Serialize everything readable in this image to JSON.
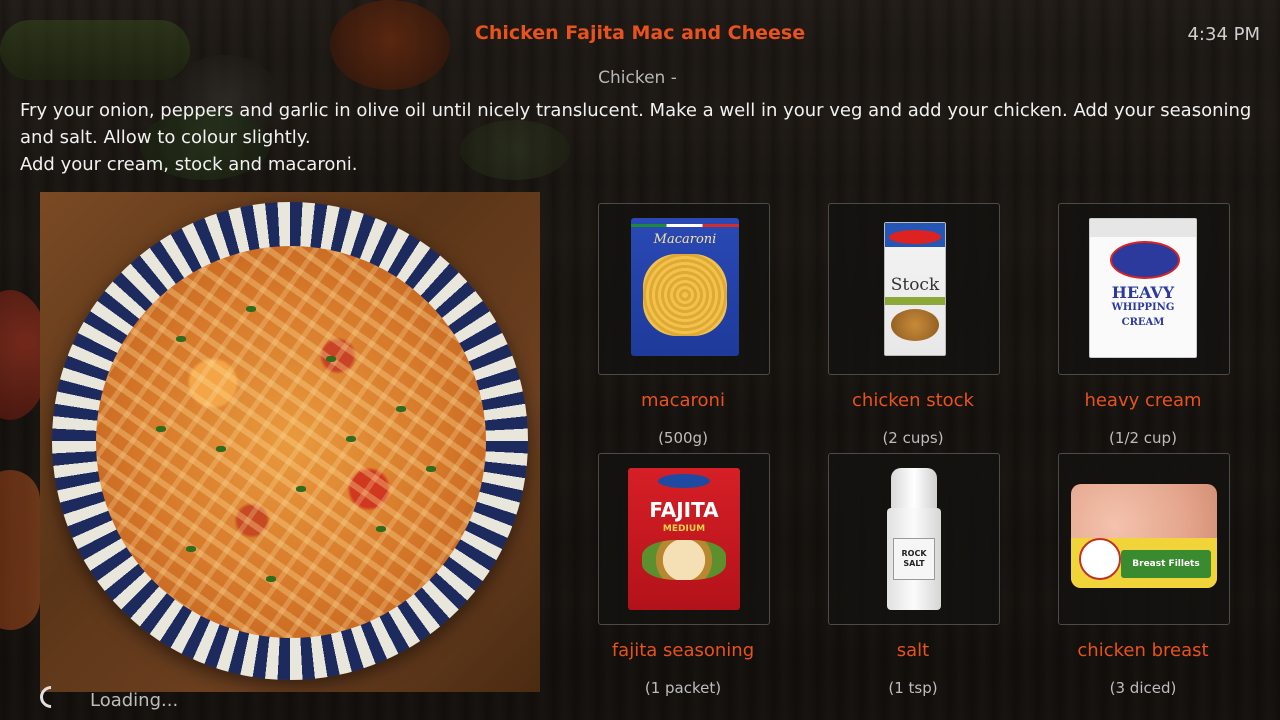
{
  "header": {
    "title": "Chicken Fajita Mac and Cheese",
    "clock": "4:34 PM",
    "category": "Chicken -"
  },
  "instructions": {
    "lines": [
      "Fry your onion, peppers and garlic in olive oil until nicely translucent. Make a well in your veg and add your chicken. Add your seasoning and salt. Allow to colour slightly.",
      "Add your cream, stock and macaroni."
    ]
  },
  "ingredients": [
    {
      "name": "macaroni",
      "quantity": "(500g)",
      "icon": "macaroni-package-icon",
      "package_text": "Macaroni"
    },
    {
      "name": "chicken stock",
      "quantity": "(2 cups)",
      "icon": "chicken-stock-carton-icon",
      "package_text": "Stock"
    },
    {
      "name": "heavy cream",
      "quantity": "(1/2 cup)",
      "icon": "heavy-cream-carton-icon",
      "package_text": "HEAVY",
      "package_subtext": "WHIPPING CREAM"
    },
    {
      "name": "fajita seasoning",
      "quantity": "(1 packet)",
      "icon": "fajita-seasoning-packet-icon",
      "package_text": "FAJITA",
      "package_subtext": "MEDIUM"
    },
    {
      "name": "salt",
      "quantity": "(1 tsp)",
      "icon": "salt-grinder-icon",
      "package_text": "ROCK SALT"
    },
    {
      "name": "chicken breast",
      "quantity": "(3 diced)",
      "icon": "chicken-breast-package-icon",
      "package_text": "Breast Fillets"
    }
  ],
  "status": {
    "loading_text": "Loading..."
  },
  "colors": {
    "accent": "#e8521c",
    "text": "#f1f1f1",
    "muted": "#bdbdbd"
  }
}
